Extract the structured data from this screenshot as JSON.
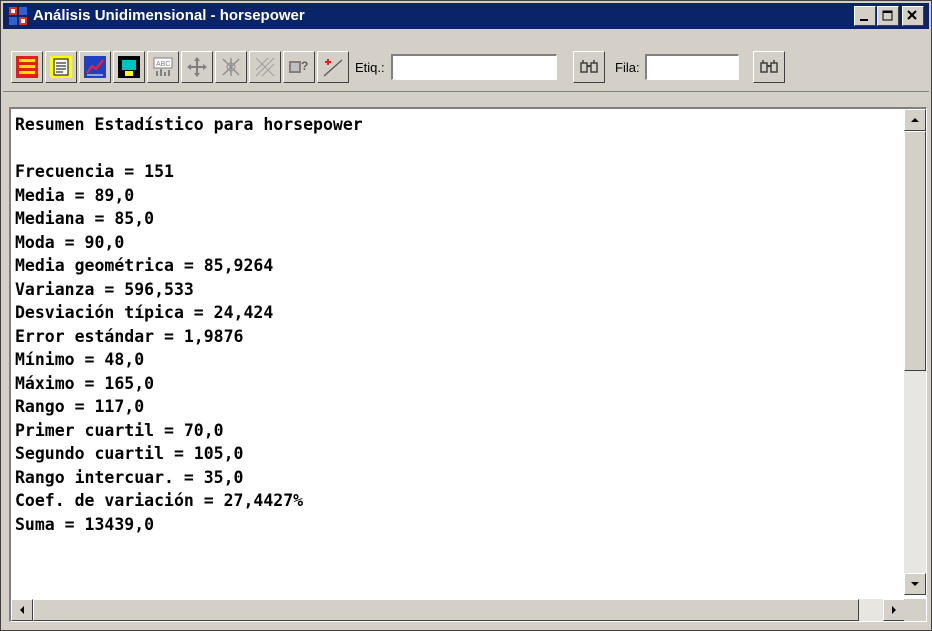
{
  "window": {
    "title": "Análisis Unidimensional - horsepower"
  },
  "toolbar": {
    "etiq_label": "Etiq.:",
    "etiq_value": "",
    "fila_label": "Fila:",
    "fila_value": "",
    "icons": [
      "input-dialog-icon",
      "tables-icon",
      "graphs-icon",
      "save-results-icon",
      "report-icon",
      "move-icon",
      "analysis-options-icon",
      "pane-options-icon",
      "help-icon",
      "plot-icon",
      "search-icon",
      "search-icon"
    ]
  },
  "content": {
    "lines": [
      "Resumen Estadístico para horsepower",
      "",
      "Frecuencia = 151",
      "Media = 89,0",
      "Mediana = 85,0",
      "Moda = 90,0",
      "Media geométrica = 85,9264",
      "Varianza = 596,533",
      "Desviación típica = 24,424",
      "Error estándar = 1,9876",
      "Mínimo = 48,0",
      "Máximo = 165,0",
      "Rango = 117,0",
      "Primer cuartil = 70,0",
      "Segundo cuartil = 105,0",
      "Rango intercuar. = 35,0",
      "Coef. de variación = 27,4427%",
      "Suma = 13439,0"
    ]
  },
  "colors": {
    "titlebar": "#0a246a",
    "face": "#d4d0c8",
    "text": "#000000"
  }
}
